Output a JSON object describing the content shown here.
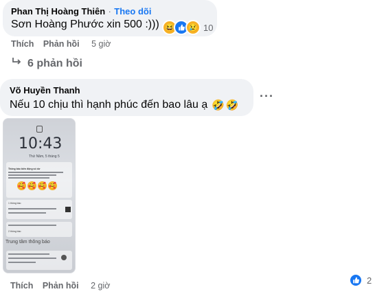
{
  "comment1": {
    "author": "Phan Thị Hoàng Thiên",
    "separator": "·",
    "follow": "Theo dõi",
    "text": "Sơn Hoàng Phước xin 500 :)))",
    "reaction_count": "10",
    "reactions": [
      "haha",
      "like",
      "sad"
    ],
    "like_label": "Thích",
    "reply_label": "Phản hồi",
    "time": "5 giờ"
  },
  "replies_toggle": {
    "label": "6 phản hồi"
  },
  "comment2": {
    "author": "Võ Huyền Thanh",
    "text": "Nếu 10 chịu thì hạnh phúc đến bao lâu ạ",
    "more_label": "···",
    "reaction_count": "2",
    "like_label": "Thích",
    "reply_label": "Phản hồi",
    "time": "2 giờ",
    "attachment": {
      "time": "10:43",
      "date": "Thứ Năm, 5 tháng 5",
      "notif_title": "Thông báo biến động số dư",
      "section_label": "Trung tâm thông báo",
      "one_notice": "1 thông báo",
      "two_notice": "2 thông báo"
    }
  },
  "colors": {
    "bubble": "#f0f2f5",
    "accent": "#1877f2",
    "muted": "#65676b"
  }
}
